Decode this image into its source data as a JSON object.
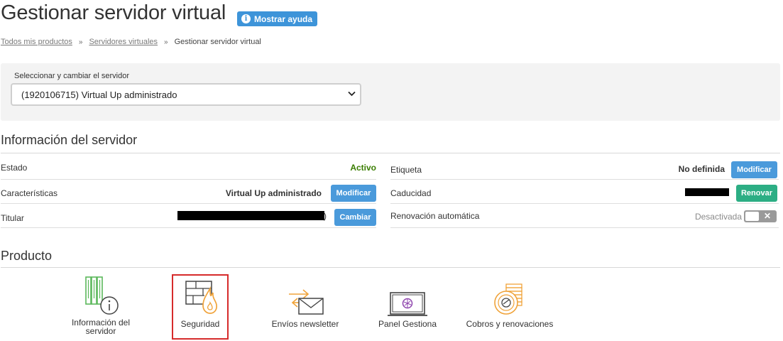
{
  "header": {
    "title": "Gestionar servidor virtual",
    "help_button": "Mostrar ayuda",
    "info_glyph": "i"
  },
  "breadcrumb": {
    "items": [
      "Todos mis productos",
      "Servidores virtuales"
    ],
    "separator": "»",
    "current": "Gestionar servidor virtual"
  },
  "server_selector": {
    "label": "Seleccionar y cambiar el servidor",
    "selected": "(1920106715) Virtual Up administrado"
  },
  "server_info": {
    "title": "Información del servidor",
    "left": [
      {
        "label": "Estado",
        "value": "Activo",
        "button": ""
      },
      {
        "label": "Características",
        "value": "Virtual Up administrado",
        "button": "Modificar"
      },
      {
        "label": "Titular",
        "value": ")",
        "button": "Cambiar"
      }
    ],
    "right": [
      {
        "label": "Etiqueta",
        "value": "No definida",
        "button": "Modificar"
      },
      {
        "label": "Caducidad",
        "value": "",
        "button": "Renovar"
      },
      {
        "label": "Renovación automática",
        "value": "Desactivada",
        "toggle_glyph": "✕"
      }
    ]
  },
  "product": {
    "title": "Producto",
    "tiles": [
      {
        "label_line1": "Información del",
        "label_line2": "servidor",
        "icon": "server-info-icon"
      },
      {
        "label_line1": "Seguridad",
        "label_line2": "",
        "icon": "firewall-icon"
      },
      {
        "label_line1": "Envíos newsletter",
        "label_line2": "",
        "icon": "newsletter-icon"
      },
      {
        "label_line1": "Panel Gestiona",
        "label_line2": "",
        "icon": "monitor-panel-icon"
      },
      {
        "label_line1": "Cobros y renovaciones",
        "label_line2": "",
        "icon": "coins-renewal-icon"
      }
    ]
  },
  "colors": {
    "active_status": "#3a7d00",
    "primary_button": "#4a9adb",
    "renew_button": "#2cae84",
    "selected_border": "#d62b2b",
    "icon_green": "#5cb85c",
    "icon_orange": "#f0a33a"
  }
}
